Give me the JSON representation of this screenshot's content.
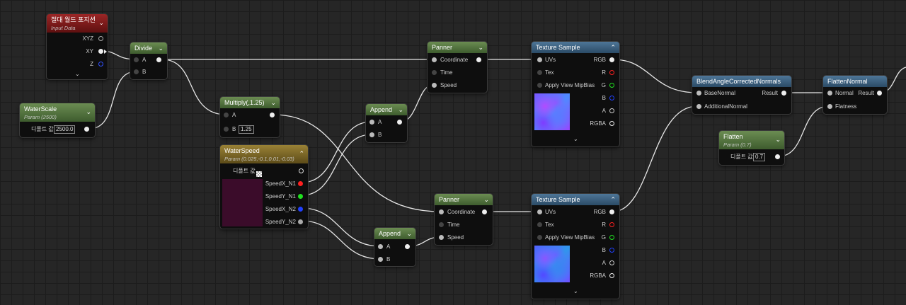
{
  "nodes": {
    "abs_world_pos": {
      "title": "절대 월드 포지션",
      "subtitle": "Input Data",
      "outputs": [
        "XYZ",
        "XY",
        "Z"
      ]
    },
    "water_scale": {
      "title": "WaterScale",
      "subtitle": "Param (2500)",
      "default_label": "디폴트 값",
      "default_value": "2500.0"
    },
    "divide": {
      "title": "Divide",
      "inputs": [
        "A",
        "B"
      ]
    },
    "multiply": {
      "title": "Multiply(,1.25)",
      "inputs": [
        "A",
        "B"
      ],
      "b_value": "1.25"
    },
    "water_speed": {
      "title": "WaterSpeed",
      "subtitle": "Param (0.025,-0.1,0.01,-0.03)",
      "default_label": "디폴트 값",
      "outputs": [
        "SpeedX_N1",
        "SpeedY_N1",
        "SpeedX_N2",
        "SpeedY_N2"
      ]
    },
    "append_top": {
      "title": "Append",
      "inputs": [
        "A",
        "B"
      ]
    },
    "append_bottom": {
      "title": "Append",
      "inputs": [
        "A",
        "B"
      ]
    },
    "panner_top": {
      "title": "Panner",
      "inputs": [
        "Coordinate",
        "Time",
        "Speed"
      ]
    },
    "panner_bottom": {
      "title": "Panner",
      "inputs": [
        "Coordinate",
        "Time",
        "Speed"
      ]
    },
    "texture_top": {
      "title": "Texture Sample",
      "inputs": [
        "UVs",
        "Tex",
        "Apply View MipBias"
      ],
      "outputs": [
        "RGB",
        "R",
        "G",
        "B",
        "A",
        "RGBA"
      ]
    },
    "texture_bottom": {
      "title": "Texture Sample",
      "inputs": [
        "UVs",
        "Tex",
        "Apply View MipBias"
      ],
      "outputs": [
        "RGB",
        "R",
        "G",
        "B",
        "A",
        "RGBA"
      ]
    },
    "blend": {
      "title": "BlendAngleCorrectedNormals",
      "inputs": [
        "BaseNormal",
        "AdditionalNormal"
      ],
      "output": "Result"
    },
    "flatten_normal": {
      "title": "FlattenNormal",
      "inputs": [
        "Normal",
        "Flatness"
      ],
      "output": "Result"
    },
    "flatten": {
      "title": "Flatten",
      "subtitle": "Param (0.7)",
      "default_label": "디폴트 값",
      "default_value": "0.7"
    }
  },
  "icons": {
    "expand": "chevron-down-icon",
    "collapse": "chevron-up-icon"
  },
  "colors": {
    "canvas": "#262626",
    "header_green": "#4e6e3e",
    "header_blue": "#3a5e7e",
    "header_red": "#7a1a1a",
    "header_gold": "#7a6426",
    "pin_red": "#ff2020",
    "pin_green": "#20e020",
    "pin_blue": "#2040ff"
  }
}
